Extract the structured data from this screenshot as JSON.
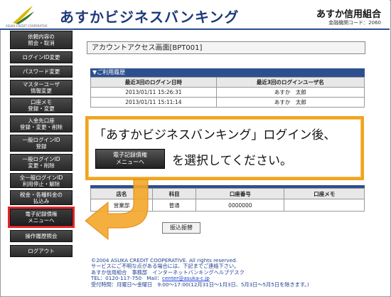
{
  "header": {
    "logo_text": "ASUKA CREDIT COOPERATIVE",
    "title": "あすかビジネスバンキング",
    "bank_name": "あすか信用組合",
    "bank_code": "金融機関コード：2060"
  },
  "sidebar": {
    "items": [
      {
        "label": "依頼内容の\n照会・取消"
      },
      {
        "label": "ログインID変更"
      },
      {
        "label": "パスワード変更"
      },
      {
        "label": "マスターユーザ\n情報変更"
      },
      {
        "label": "口座メモ\n登録・変更"
      },
      {
        "label": "入金先口座\n登録・変更・削除"
      },
      {
        "label": "一般ログインID\n登録"
      },
      {
        "label": "一般ログインID\n変更・削除"
      },
      {
        "label": "全一般ログインID\n利用停止・解除"
      },
      {
        "label": "税金・各種料金の\n払込み"
      },
      {
        "label": "電子記録債権\nメニューへ"
      },
      {
        "label": "操作履歴照会"
      },
      {
        "label": "ログアウト"
      }
    ]
  },
  "main": {
    "page_title": "アカウントアクセス画面[BPT001]",
    "history_section": "▼ご利用履歴",
    "history_headers": [
      "最近3回のログイン日時",
      "最近3回のログインユーザ名"
    ],
    "history_rows": [
      [
        "2013/01/11 15:26:31",
        "あすか　太郎"
      ],
      [
        "2013/01/11 15:11:14",
        "あすか　太郎"
      ]
    ],
    "account_headers": [
      "店名",
      "科目",
      "口座番号",
      "口座メモ"
    ],
    "account_row": [
      "営業部",
      "普通",
      "0000000",
      ""
    ],
    "transfer_button": "振込振替"
  },
  "callout": {
    "line1": "「あすかビジネスバンキング」ログイン後、",
    "button": "電子記録債権\nメニューへ",
    "line2": "を選択してください。"
  },
  "footer": {
    "line1": "©2004 ASUKA CREDIT COOPERATIVE. All rights reserved.",
    "line2": "サービスにご不明な点がある場合には、下記までご連絡下さい。",
    "line3": "あすか信用組合　事務部　インターネットバンキングヘルプデスク",
    "line4": "TEL：0120-117-750　Mail：",
    "mail": "center@asuka-c.jp",
    "line5": "受付時間：月曜日～金曜日　9:00～17:00(12月31日～1月3日、5月3日～5月5日を除きます。)"
  },
  "colors": {
    "accent": "#2c4f8f",
    "highlight": "#e2262a",
    "callout_border": "#f0a51e"
  }
}
